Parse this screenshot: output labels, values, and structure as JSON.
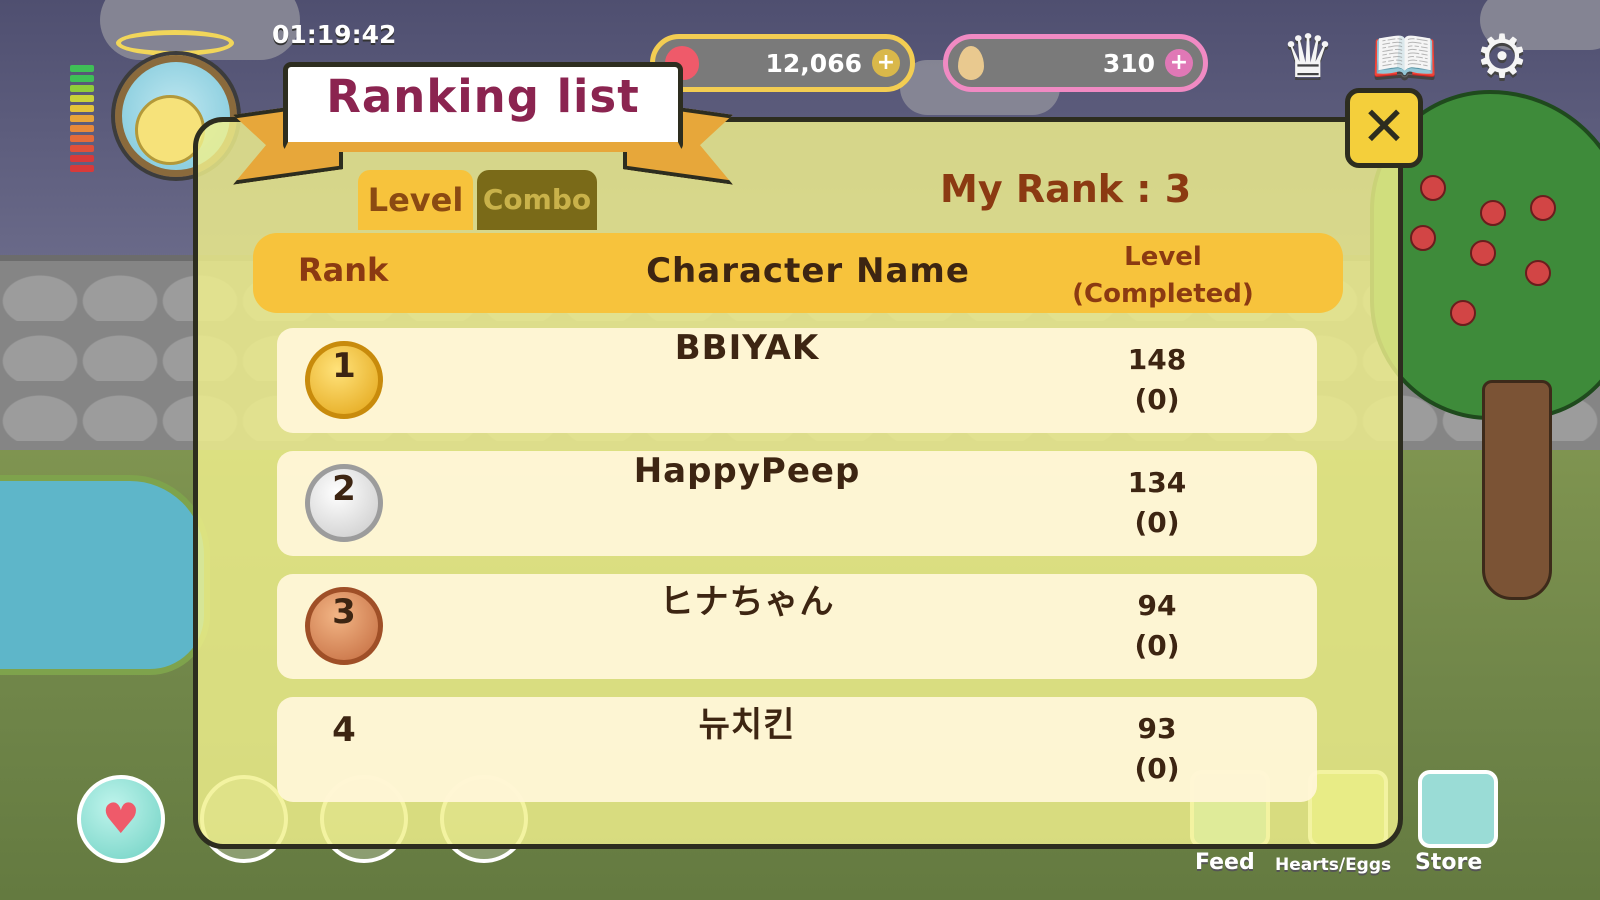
{
  "hud": {
    "time": "01:19:42",
    "hearts": "12,066",
    "eggs": "310",
    "heart_plus": "+",
    "egg_plus": "+"
  },
  "panel": {
    "title": "Ranking list",
    "close_label": "✕",
    "tabs": [
      {
        "label": "Level",
        "active": true
      },
      {
        "label": "Combo",
        "active": false
      }
    ],
    "my_rank": "My Rank : 3",
    "columns": {
      "rank": "Rank",
      "name": "Character Name",
      "level_line1": "Level",
      "level_line2": "(Completed)"
    },
    "rows": [
      {
        "rank": "1",
        "name": "BBIYAK",
        "level": "148",
        "completed": "(0)",
        "medal": "gold"
      },
      {
        "rank": "2",
        "name": "HappyPeep",
        "level": "134",
        "completed": "(0)",
        "medal": "silver"
      },
      {
        "rank": "3",
        "name": "ヒナちゃん",
        "level": "94",
        "completed": "(0)",
        "medal": "bronze"
      },
      {
        "rank": "4",
        "name": "뉴치킨",
        "level": "93",
        "completed": "(0)",
        "medal": "none"
      }
    ]
  },
  "bottom_bar": {
    "feed": "Feed",
    "hearts_eggs": "Hearts/Eggs",
    "store": "Store"
  },
  "icons": {
    "crown": "crown-icon",
    "book": "book-icon",
    "settings": "gear-icon",
    "heart": "heart-icon",
    "egg": "egg-icon"
  },
  "colors": {
    "accent_gold": "#f7c33c",
    "title_magenta": "#8b2450",
    "rank_text": "#8b3a12",
    "heart_pill_border": "#f3cd52",
    "egg_pill_border": "#f08ac3"
  }
}
